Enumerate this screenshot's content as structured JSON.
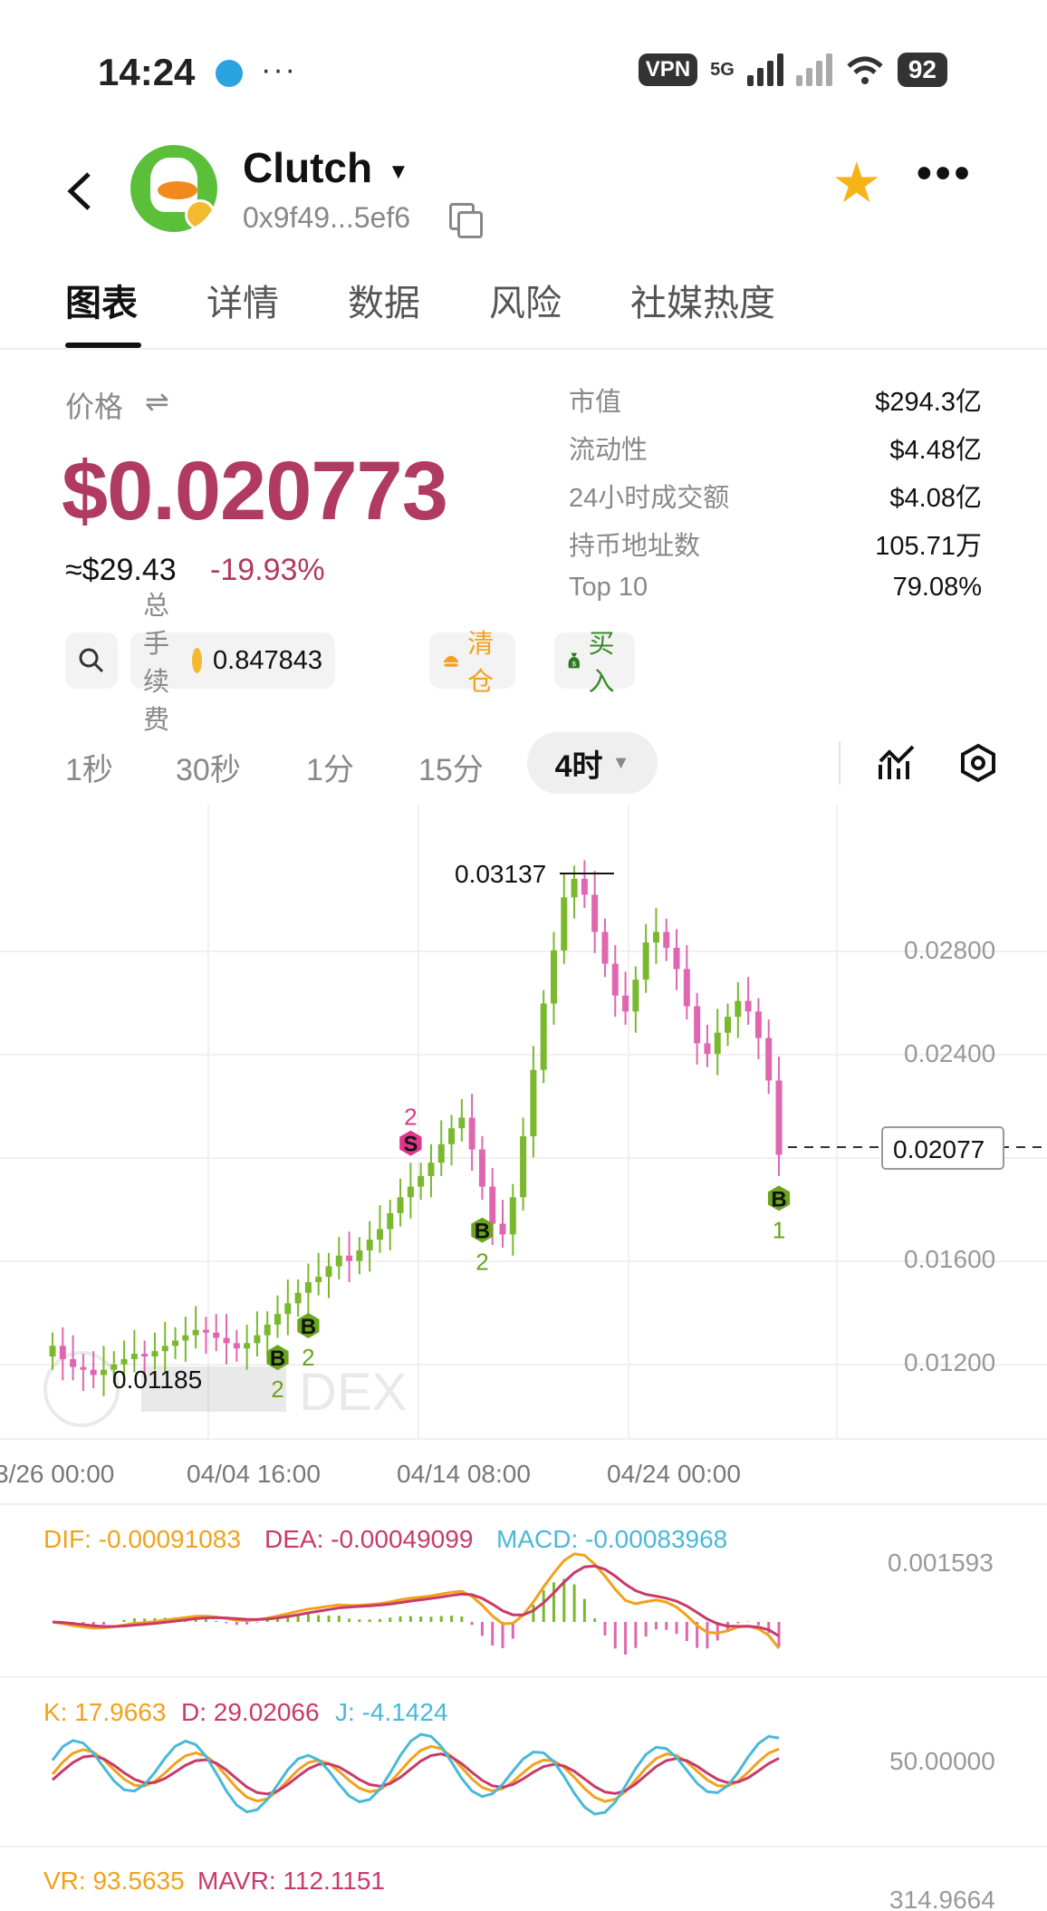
{
  "status_bar": {
    "time": "14:24",
    "dots": "···",
    "vpn": "VPN",
    "network": "5G",
    "battery": "92",
    "icons": [
      "telegram-icon",
      "signal-icon",
      "wifi-icon",
      "battery-icon"
    ]
  },
  "header": {
    "token_name": "Clutch",
    "token_address": "0x9f49...5ef6",
    "icons": [
      "back-arrow-icon",
      "copy-icon",
      "star-icon",
      "more-icon",
      "chevron-down-icon"
    ],
    "star_color": "#f6b418"
  },
  "tabs": [
    {
      "label": "图表",
      "active": true
    },
    {
      "label": "详情",
      "active": false
    },
    {
      "label": "数据",
      "active": false
    },
    {
      "label": "风险",
      "active": false
    },
    {
      "label": "社媒热度",
      "active": false
    }
  ],
  "price": {
    "label": "价格",
    "swap_icon": "swap-icon",
    "value": "$0.020773",
    "approx": "≈$29.43",
    "change": "-19.93%",
    "color": "#b03a62"
  },
  "stats": [
    {
      "label": "市值",
      "value": "$294.3亿"
    },
    {
      "label": "流动性",
      "value": "$4.48亿"
    },
    {
      "label": "24小时成交额",
      "value": "$4.08亿"
    },
    {
      "label": "持币地址数",
      "value": "105.71万"
    },
    {
      "label": "Top 10",
      "value": "79.08%"
    }
  ],
  "actions": {
    "fee_label": "总手续费",
    "fee_value": "0.847843",
    "clear_label": "清仓",
    "buy_label": "买入",
    "icons": [
      "search-icon",
      "bnb-coin-icon",
      "clear-position-icon",
      "money-bag-icon"
    ]
  },
  "intervals": {
    "options": [
      "1秒",
      "30秒",
      "1分",
      "15分"
    ],
    "active": "4时",
    "icons": [
      "indicator-icon",
      "settings-icon"
    ]
  },
  "chart_data": {
    "type": "candlestick",
    "y_ticks": [
      "0.02800",
      "0.02400",
      "0.01600",
      "0.01200"
    ],
    "x_ticks": [
      "3/26 00:00",
      "04/04 16:00",
      "04/14 08:00",
      "04/24 00:00"
    ],
    "high_label": "0.03137",
    "low_label": "0.01185",
    "current_price_label": "0.02077",
    "watermark": "DEX",
    "series_close": [
      0.0136,
      0.0131,
      0.0128,
      0.0127,
      0.0125,
      0.0127,
      0.0129,
      0.0131,
      0.0133,
      0.0132,
      0.0134,
      0.0136,
      0.0138,
      0.014,
      0.0142,
      0.0141,
      0.0139,
      0.0137,
      0.0135,
      0.0137,
      0.014,
      0.0144,
      0.0148,
      0.0152,
      0.0156,
      0.016,
      0.0162,
      0.0166,
      0.017,
      0.0168,
      0.0172,
      0.0176,
      0.018,
      0.0186,
      0.0192,
      0.0196,
      0.02,
      0.0205,
      0.0212,
      0.0218,
      0.0222,
      0.021,
      0.0196,
      0.0182,
      0.0178,
      0.0192,
      0.0215,
      0.024,
      0.0265,
      0.0285,
      0.0305,
      0.0312,
      0.0306,
      0.0292,
      0.028,
      0.0268,
      0.0262,
      0.0274,
      0.0288,
      0.0292,
      0.0286,
      0.0278,
      0.0264,
      0.025,
      0.0246,
      0.0254,
      0.026,
      0.0266,
      0.0262,
      0.0252,
      0.0236,
      0.0208
    ],
    "trade_markers": [
      {
        "label": "B",
        "count": "2",
        "type": "buy"
      },
      {
        "label": "B",
        "count": "2",
        "type": "buy"
      },
      {
        "label": "S",
        "count": "2",
        "type": "sell"
      },
      {
        "label": "B",
        "count": "2",
        "type": "buy"
      },
      {
        "label": "B",
        "count": "1",
        "type": "buy"
      }
    ],
    "up_color": "#7ab82e",
    "down_color": "#e066b0"
  },
  "macd": {
    "dif_label": "DIF: -0.00091083",
    "dea_label": "DEA: -0.00049099",
    "macd_label": "MACD: -0.00083968",
    "right_value": "0.001593",
    "colors": {
      "dif": "#f0a21c",
      "dea": "#c83a6a",
      "macd": "#4ab8d8"
    }
  },
  "kdj": {
    "k_label": "K: 17.9663",
    "d_label": "D: 29.02066",
    "j_label": "J: -4.1424",
    "right_value": "50.00000"
  },
  "vr": {
    "vr_label": "VR: 93.5635",
    "mavr_label": "MAVR: 112.1151",
    "right_value": "314.9664"
  }
}
